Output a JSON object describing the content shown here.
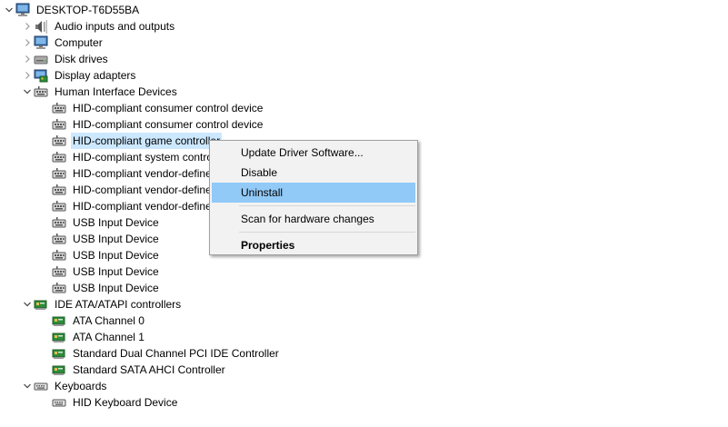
{
  "tree": {
    "root": "DESKTOP-T6D55BA",
    "categories": {
      "audio": "Audio inputs and outputs",
      "computer": "Computer",
      "disk": "Disk drives",
      "display": "Display adapters",
      "hid": "Human Interface Devices",
      "ide": "IDE ATA/ATAPI controllers",
      "keyboards": "Keyboards"
    },
    "hid_devices": [
      "HID-compliant consumer control device",
      "HID-compliant consumer control device",
      "HID-compliant game controller",
      "HID-compliant system controller",
      "HID-compliant vendor-defined device",
      "HID-compliant vendor-defined device",
      "HID-compliant vendor-defined device",
      "USB Input Device",
      "USB Input Device",
      "USB Input Device",
      "USB Input Device",
      "USB Input Device"
    ],
    "ide_devices": [
      "ATA Channel 0",
      "ATA Channel 1",
      "Standard Dual Channel PCI IDE Controller",
      "Standard SATA AHCI Controller"
    ],
    "keyboard_devices": [
      "HID Keyboard Device"
    ]
  },
  "context_menu": {
    "update_driver": "Update Driver Software...",
    "disable": "Disable",
    "uninstall": "Uninstall",
    "scan": "Scan for hardware changes",
    "properties": "Properties",
    "hovered": "Uninstall"
  },
  "icons": {
    "computer": "computer-icon",
    "audio": "speaker-icon",
    "disk": "disk-drive-icon",
    "display": "display-adapter-icon",
    "hid": "hid-device-icon",
    "ide": "ide-controller-icon",
    "keyboard": "keyboard-icon"
  }
}
